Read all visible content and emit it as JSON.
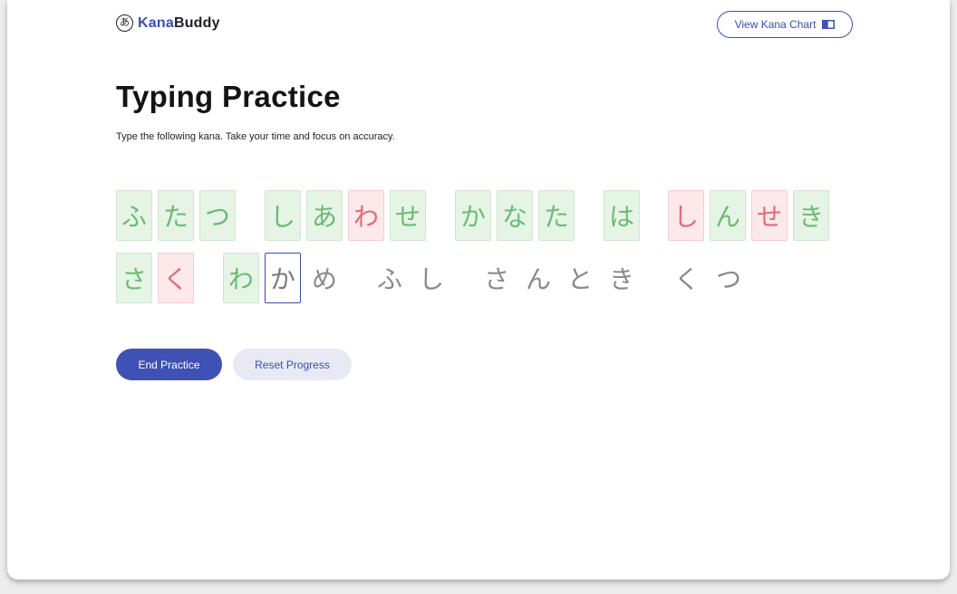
{
  "header": {
    "logo_glyph": "あ",
    "logo_part1": "Kana",
    "logo_part2": "Buddy",
    "chart_button_label": "View Kana Chart",
    "chart_button_icon": "book-icon"
  },
  "main": {
    "title": "Typing Practice",
    "subtitle": "Type the following kana. Take your time and focus on accuracy."
  },
  "kana_rows": [
    [
      {
        "char": "ふ",
        "status": "correct"
      },
      {
        "char": "た",
        "status": "correct"
      },
      {
        "char": "つ",
        "status": "correct"
      },
      {
        "char": "し",
        "status": "correct"
      },
      {
        "char": "あ",
        "status": "correct"
      },
      {
        "char": "わ",
        "status": "incorrect"
      },
      {
        "char": "せ",
        "status": "correct"
      },
      {
        "char": "か",
        "status": "correct"
      },
      {
        "char": "な",
        "status": "correct"
      },
      {
        "char": "た",
        "status": "correct"
      },
      {
        "char": "は",
        "status": "correct"
      },
      {
        "char": "し",
        "status": "incorrect"
      },
      {
        "char": "ん",
        "status": "correct"
      },
      {
        "char": "せ",
        "status": "incorrect"
      },
      {
        "char": "き",
        "status": "correct"
      }
    ],
    [
      {
        "char": "さ",
        "status": "correct"
      },
      {
        "char": "く",
        "status": "incorrect"
      },
      {
        "char": "わ",
        "status": "correct"
      },
      {
        "char": "か",
        "status": "current"
      },
      {
        "char": "め",
        "status": "pending"
      },
      {
        "char": "ふ",
        "status": "pending"
      },
      {
        "char": "し",
        "status": "pending"
      },
      {
        "char": "さ",
        "status": "pending"
      },
      {
        "char": "ん",
        "status": "pending"
      },
      {
        "char": "と",
        "status": "pending"
      },
      {
        "char": "き",
        "status": "pending"
      },
      {
        "char": "く",
        "status": "pending"
      },
      {
        "char": "つ",
        "status": "pending"
      }
    ]
  ],
  "actions": {
    "end_label": "End Practice",
    "reset_label": "Reset Progress"
  },
  "colors": {
    "accent": "#3f51b5",
    "correct_bg": "#e6f4e6",
    "correct_text": "#6bbb75",
    "incorrect_bg": "#fde8ea",
    "incorrect_text": "#e26c76",
    "pending_text": "#8a8a8a"
  }
}
